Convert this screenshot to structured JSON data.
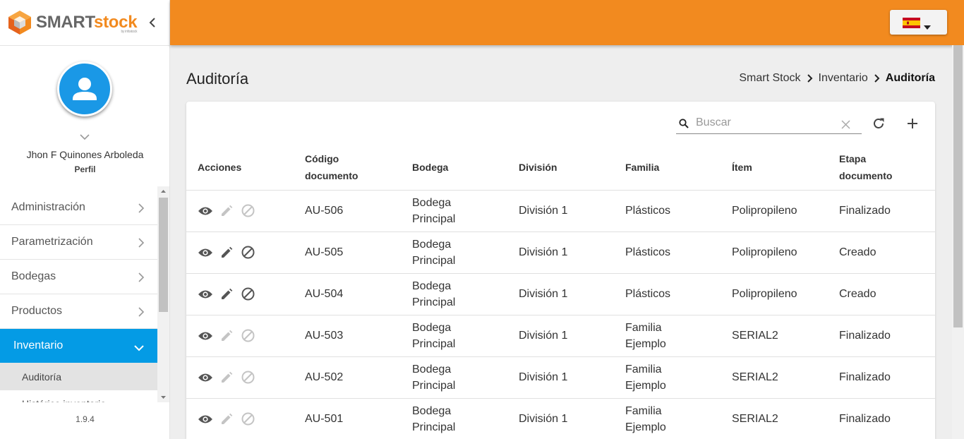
{
  "brand": {
    "name_a": "SMART",
    "name_b": "stock",
    "sub": "by infostock"
  },
  "user": {
    "name": "Jhon F Quinones Arboleda",
    "profile_link": "Perfil"
  },
  "sidebar": {
    "items": [
      {
        "label": "Administración"
      },
      {
        "label": "Parametrización"
      },
      {
        "label": "Bodegas"
      },
      {
        "label": "Productos"
      },
      {
        "label": "Inventario"
      }
    ],
    "submenu": [
      {
        "label": "Auditoría"
      },
      {
        "label": "Histórico inventario"
      }
    ],
    "version": "1.9.4"
  },
  "header": {
    "language": "es",
    "icons": [
      "flag-spain-icon",
      "caret-down-icon"
    ]
  },
  "page": {
    "title": "Auditoría",
    "breadcrumb": [
      "Smart Stock",
      "Inventario",
      "Auditoría"
    ]
  },
  "search": {
    "placeholder": "Buscar",
    "value": ""
  },
  "table": {
    "headers": {
      "actions": "Acciones",
      "code_1": "Código",
      "code_2": "documento",
      "warehouse": "Bodega",
      "division": "División",
      "family": "Familia",
      "item": "Ítem",
      "stage_1": "Etapa",
      "stage_2": "documento"
    },
    "rows": [
      {
        "code": "AU-506",
        "wh1": "Bodega",
        "wh2": "Principal",
        "division": "División 1",
        "fam1": "Plásticos",
        "fam2": "",
        "item": "Polipropileno",
        "stage": "Finalizado",
        "editable": false
      },
      {
        "code": "AU-505",
        "wh1": "Bodega",
        "wh2": "Principal",
        "division": "División 1",
        "fam1": "Plásticos",
        "fam2": "",
        "item": "Polipropileno",
        "stage": "Creado",
        "editable": true
      },
      {
        "code": "AU-504",
        "wh1": "Bodega",
        "wh2": "Principal",
        "division": "División 1",
        "fam1": "Plásticos",
        "fam2": "",
        "item": "Polipropileno",
        "stage": "Creado",
        "editable": true
      },
      {
        "code": "AU-503",
        "wh1": "Bodega",
        "wh2": "Principal",
        "division": "División 1",
        "fam1": "Familia",
        "fam2": "Ejemplo",
        "item": "SERIAL2",
        "stage": "Finalizado",
        "editable": false
      },
      {
        "code": "AU-502",
        "wh1": "Bodega",
        "wh2": "Principal",
        "division": "División 1",
        "fam1": "Familia",
        "fam2": "Ejemplo",
        "item": "SERIAL2",
        "stage": "Finalizado",
        "editable": false
      },
      {
        "code": "AU-501",
        "wh1": "Bodega",
        "wh2": "Principal",
        "division": "División 1",
        "fam1": "Familia",
        "fam2": "Ejemplo",
        "item": "SERIAL2",
        "stage": "Finalizado",
        "editable": false
      }
    ]
  },
  "colors": {
    "accent": "#f28a1f",
    "active_menu": "#049be5",
    "avatar": "#1a98e6",
    "icon_active": "#555555",
    "icon_disabled": "#c4c4c4"
  }
}
